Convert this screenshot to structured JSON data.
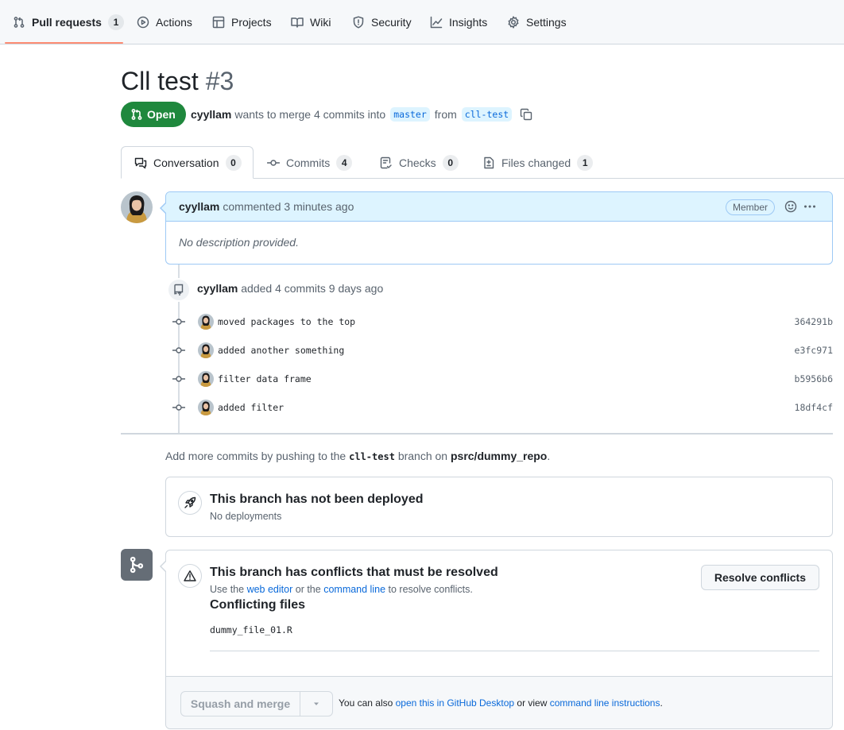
{
  "repo_nav": {
    "items": [
      {
        "label": "Pull requests",
        "count": "1",
        "icon": "git-pull-request-icon"
      },
      {
        "label": "Actions",
        "icon": "play-icon"
      },
      {
        "label": "Projects",
        "icon": "table-icon"
      },
      {
        "label": "Wiki",
        "icon": "book-icon"
      },
      {
        "label": "Security",
        "icon": "shield-icon"
      },
      {
        "label": "Insights",
        "icon": "graph-icon"
      },
      {
        "label": "Settings",
        "icon": "gear-icon"
      }
    ]
  },
  "pr": {
    "title": "Cll test",
    "number": "#3",
    "state": "Open",
    "author": "cyyllam",
    "merge_text": "wants to merge 4 commits into",
    "base_branch": "master",
    "from_text": "from",
    "head_branch": "cll-test"
  },
  "tabs": [
    {
      "label": "Conversation",
      "count": "0"
    },
    {
      "label": "Commits",
      "count": "4"
    },
    {
      "label": "Checks",
      "count": "0"
    },
    {
      "label": "Files changed",
      "count": "1"
    }
  ],
  "comment": {
    "author": "cyyllam",
    "action": "commented 3 minutes ago",
    "role_badge": "Member",
    "body": "No description provided."
  },
  "push_event": {
    "author": "cyyllam",
    "text": "added 4 commits 9 days ago"
  },
  "commits": [
    {
      "message": "moved packages to the top",
      "sha": "364291b"
    },
    {
      "message": "added another something",
      "sha": "e3fc971"
    },
    {
      "message": "filter data frame",
      "sha": "b5956b6"
    },
    {
      "message": "added filter",
      "sha": "18df4cf"
    }
  ],
  "hint": {
    "prefix": "Add more commits by pushing to the",
    "branch": "cll-test",
    "middle": "branch on",
    "repo": "psrc/dummy_repo",
    "suffix": "."
  },
  "deploy": {
    "title": "This branch has not been deployed",
    "subtitle": "No deployments"
  },
  "conflicts": {
    "title": "This branch has conflicts that must be resolved",
    "use_the": "Use the",
    "web_editor": "web editor",
    "or_the": "or the",
    "command_line": "command line",
    "to_resolve": "to resolve conflicts.",
    "files_heading": "Conflicting files",
    "files": [
      "dummy_file_01.R"
    ],
    "resolve_button": "Resolve conflicts"
  },
  "merge_footer": {
    "button": "Squash and merge",
    "you_can_also": "You can also",
    "desktop_link": "open this in GitHub Desktop",
    "or_view": "or view",
    "cli_link": "command line instructions",
    "period": "."
  },
  "colors": {
    "open_green": "#1f883d",
    "link_blue": "#0969da",
    "comment_header_bg": "#ddf4ff",
    "nav_underline": "#fd8c73"
  }
}
